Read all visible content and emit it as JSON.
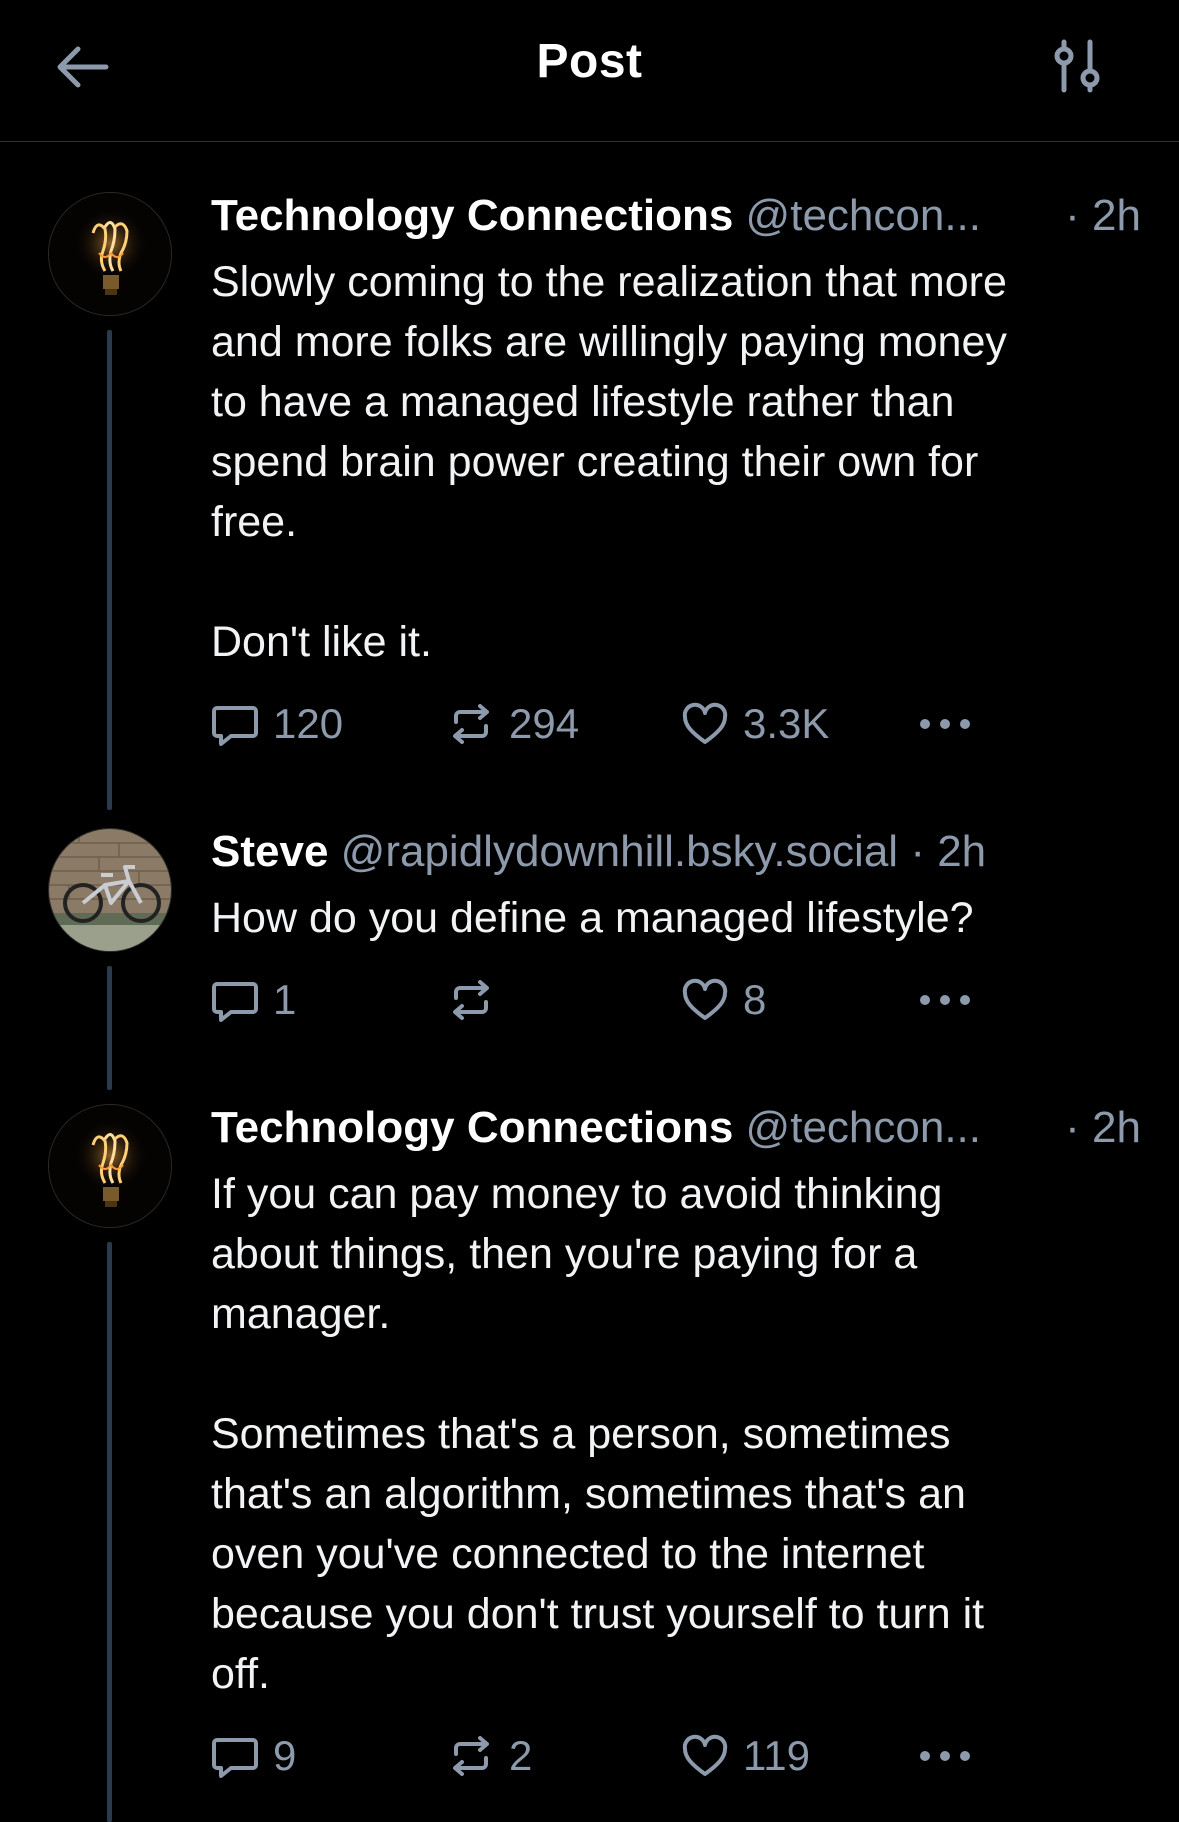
{
  "header": {
    "title": "Post",
    "back_icon": "arrow-left-icon",
    "filter_icon": "sliders-icon"
  },
  "colors": {
    "background": "#000000",
    "text": "#f1f3f5",
    "muted": "#8d9aac",
    "thread_line": "#2b3a4d"
  },
  "posts": [
    {
      "author": "Technology Connections",
      "handle": "@techcon...",
      "time": "· 2h",
      "avatar": "lightbulb-avatar",
      "text": "Slowly coming to the realization that more\nand more folks are willingly paying money\nto have a managed lifestyle rather than\nspend brain power creating their own for\nfree.\n\nDon't like it.",
      "replies": "120",
      "reposts": "294",
      "likes": "3.3K"
    },
    {
      "author": "Steve",
      "handle": "@rapidlydownhill.bsky.social",
      "time": "· 2h",
      "avatar": "bicycle-avatar",
      "text": "How do you define a managed lifestyle?",
      "replies": "1",
      "reposts": "",
      "likes": "8"
    },
    {
      "author": "Technology Connections",
      "handle": "@techcon...",
      "time": "· 2h",
      "avatar": "lightbulb-avatar",
      "text": "If you can pay money to avoid thinking\nabout things, then you're paying for a\nmanager.\n\nSometimes that's a person, sometimes\nthat's an algorithm, sometimes that's an\noven you've connected to the internet\nbecause you don't trust yourself to turn it\noff.",
      "replies": "9",
      "reposts": "2",
      "likes": "119"
    }
  ]
}
